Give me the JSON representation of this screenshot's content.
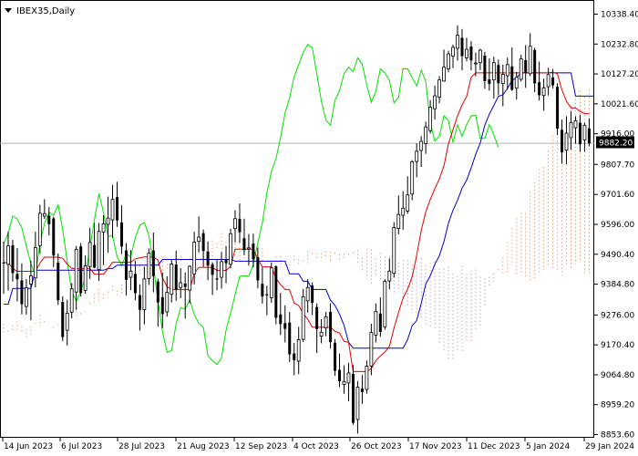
{
  "chart_data": {
    "type": "candlestick",
    "title": "IBEX35,Daily",
    "current_price_label": "9882.20",
    "current_price": 9882.2,
    "y_ticks": [
      "10338.40",
      "10232.80",
      "10127.20",
      "10021.60",
      "9916.00",
      "9807.70",
      "9701.60",
      "9596.00",
      "9490.40",
      "9384.80",
      "9276.00",
      "9170.40",
      "9064.80",
      "8959.20",
      "8853.60"
    ],
    "x_ticks": [
      "14 Jun 2023",
      "6 Jul 2023",
      "28 Jul 2023",
      "21 Aug 2023",
      "12 Sep 2023",
      "4 Oct 2023",
      "26 Oct 2023",
      "17 Nov 2023",
      "11 Dec 2023",
      "5 Jan 2024",
      "29 Jan 2024"
    ],
    "ylim": [
      8853.6,
      10338.4
    ],
    "colors": {
      "candle": "#000000",
      "tenkan_sen": "#e00000",
      "kijun_sen": "#0000c8",
      "chikou_span": "#00e000",
      "cloud_bull": "#f0a070",
      "cloud_bear": "#c8a0c8",
      "price_line": "#b0b0b0"
    },
    "candles": [
      [
        9461,
        9535,
        9351,
        9459
      ],
      [
        9455,
        9570,
        9362,
        9520
      ],
      [
        9522,
        9541,
        9394,
        9424
      ],
      [
        9421,
        9512,
        9324,
        9402
      ],
      [
        9398,
        9458,
        9278,
        9314
      ],
      [
        9306,
        9403,
        9277,
        9372
      ],
      [
        9385,
        9468,
        9257,
        9414
      ],
      [
        9407,
        9570,
        9373,
        9514
      ],
      [
        9521,
        9665,
        9492,
        9635
      ],
      [
        9625,
        9685,
        9615,
        9634
      ],
      [
        9627,
        9657,
        9557,
        9597
      ],
      [
        9617,
        9623,
        9445,
        9486
      ],
      [
        9461,
        9493,
        9311,
        9328
      ],
      [
        9322,
        9342,
        9184,
        9198
      ],
      [
        9222,
        9330,
        9168,
        9282
      ],
      [
        9286,
        9389,
        9264,
        9368
      ],
      [
        9357,
        9520,
        9294,
        9508
      ],
      [
        9518,
        9530,
        9341,
        9354
      ],
      [
        9363,
        9486,
        9351,
        9449
      ],
      [
        9447,
        9584,
        9403,
        9532
      ],
      [
        9523,
        9601,
        9441,
        9443
      ],
      [
        9436,
        9601,
        9396,
        9571
      ],
      [
        9569,
        9628,
        9452,
        9598
      ],
      [
        9596,
        9694,
        9496,
        9618
      ],
      [
        9612,
        9736,
        9548,
        9684
      ],
      [
        9692,
        9746,
        9587,
        9610
      ],
      [
        9603,
        9664,
        9491,
        9518
      ],
      [
        9504,
        9530,
        9344,
        9400
      ],
      [
        9409,
        9505,
        9364,
        9431
      ],
      [
        9421,
        9467,
        9328,
        9353
      ],
      [
        9346,
        9384,
        9221,
        9294
      ],
      [
        9295,
        9446,
        9243,
        9403
      ],
      [
        9404,
        9511,
        9382,
        9494
      ],
      [
        9504,
        9567,
        9356,
        9413
      ],
      [
        9394,
        9404,
        9235,
        9320
      ],
      [
        9339,
        9425,
        9230,
        9279
      ],
      [
        9287,
        9413,
        9270,
        9356
      ],
      [
        9349,
        9470,
        9320,
        9456
      ],
      [
        9454,
        9503,
        9326,
        9365
      ],
      [
        9373,
        9442,
        9335,
        9390
      ],
      [
        9387,
        9426,
        9263,
        9375
      ],
      [
        9364,
        9451,
        9317,
        9448
      ],
      [
        9421,
        9570,
        9384,
        9533
      ],
      [
        9536,
        9624,
        9497,
        9551
      ],
      [
        9565,
        9578,
        9446,
        9502
      ],
      [
        9500,
        9536,
        9399,
        9450
      ],
      [
        9455,
        9462,
        9347,
        9418
      ],
      [
        9405,
        9470,
        9363,
        9401
      ],
      [
        9409,
        9498,
        9369,
        9464
      ],
      [
        9473,
        9520,
        9388,
        9459
      ],
      [
        9455,
        9580,
        9441,
        9563
      ],
      [
        9581,
        9646,
        9532,
        9616
      ],
      [
        9615,
        9670,
        9530,
        9568
      ],
      [
        9547,
        9616,
        9487,
        9505
      ],
      [
        9509,
        9562,
        9450,
        9513
      ],
      [
        9528,
        9563,
        9444,
        9473
      ],
      [
        9480,
        9514,
        9370,
        9398
      ],
      [
        9386,
        9444,
        9316,
        9341
      ],
      [
        9349,
        9379,
        9275,
        9345
      ],
      [
        9337,
        9461,
        9319,
        9442
      ],
      [
        9448,
        9451,
        9243,
        9266
      ],
      [
        9278,
        9354,
        9205,
        9244
      ],
      [
        9247,
        9310,
        9179,
        9227
      ],
      [
        9249,
        9287,
        9110,
        9137
      ],
      [
        9140,
        9177,
        9063,
        9116
      ],
      [
        9113,
        9234,
        9067,
        9189
      ],
      [
        9190,
        9368,
        9181,
        9340
      ],
      [
        9326,
        9403,
        9284,
        9373
      ],
      [
        9380,
        9391,
        9275,
        9319
      ],
      [
        9304,
        9317,
        9142,
        9226
      ],
      [
        9201,
        9261,
        9176,
        9215
      ],
      [
        9230,
        9287,
        9201,
        9270
      ],
      [
        9287,
        9317,
        9158,
        9180
      ],
      [
        9178,
        9191,
        9061,
        9079
      ],
      [
        9082,
        9140,
        9021,
        9042
      ],
      [
        9031,
        9098,
        8998,
        9041
      ],
      [
        9036,
        9107,
        8971,
        9071
      ],
      [
        9068,
        9099,
        8888,
        8895
      ],
      [
        8907,
        9043,
        8857,
        9021
      ],
      [
        9016,
        9064,
        8962,
        9004
      ],
      [
        9013,
        9115,
        8998,
        9095
      ],
      [
        9096,
        9245,
        9063,
        9214
      ],
      [
        9205,
        9317,
        9179,
        9289
      ],
      [
        9281,
        9338,
        9199,
        9216
      ],
      [
        9234,
        9402,
        9224,
        9395
      ],
      [
        9396,
        9476,
        9366,
        9431
      ],
      [
        9423,
        9604,
        9408,
        9585
      ],
      [
        9581,
        9698,
        9561,
        9631
      ],
      [
        9628,
        9713,
        9577,
        9653
      ],
      [
        9643,
        9766,
        9633,
        9700
      ],
      [
        9703,
        9823,
        9681,
        9817
      ],
      [
        9818,
        9882,
        9762,
        9854
      ],
      [
        9857,
        9908,
        9799,
        9889
      ],
      [
        9881,
        9959,
        9845,
        9940
      ],
      [
        9927,
        10035,
        9917,
        10010
      ],
      [
        10004,
        10086,
        9966,
        10050
      ],
      [
        10045,
        10120,
        10024,
        10106
      ],
      [
        10102,
        10213,
        10100,
        10151
      ],
      [
        10145,
        10209,
        10133,
        10198
      ],
      [
        10190,
        10231,
        10148,
        10221
      ],
      [
        10218,
        10299,
        10174,
        10264
      ],
      [
        10255,
        10286,
        10140,
        10190
      ],
      [
        10184,
        10255,
        10172,
        10214
      ],
      [
        10224,
        10243,
        10140,
        10175
      ],
      [
        10163,
        10203,
        10119,
        10166
      ],
      [
        10167,
        10216,
        10141,
        10211
      ],
      [
        10192,
        10205,
        10075,
        10102
      ],
      [
        10108,
        10182,
        10068,
        10092
      ],
      [
        10106,
        10188,
        10040,
        10167
      ],
      [
        10159,
        10178,
        10052,
        10094
      ],
      [
        10093,
        10160,
        10013,
        10126
      ],
      [
        10121,
        10185,
        10073,
        10160
      ],
      [
        10154,
        10221,
        10067,
        10071
      ],
      [
        10077,
        10134,
        10037,
        10115
      ],
      [
        10108,
        10195,
        10101,
        10181
      ],
      [
        10176,
        10229,
        10078,
        10131
      ],
      [
        10128,
        10271,
        10119,
        10225
      ],
      [
        10212,
        10220,
        10063,
        10094
      ],
      [
        10098,
        10171,
        10033,
        10052
      ],
      [
        10051,
        10111,
        9997,
        10078
      ],
      [
        10082,
        10149,
        10051,
        10125
      ],
      [
        10115,
        10145,
        10076,
        10087
      ],
      [
        10082,
        10094,
        9911,
        9934
      ],
      [
        9930,
        9966,
        9810,
        9850
      ],
      [
        9858,
        9978,
        9809,
        9918
      ],
      [
        9902,
        9995,
        9860,
        9956
      ],
      [
        9937,
        9978,
        9881,
        9962
      ],
      [
        9955,
        9983,
        9852,
        9879
      ],
      [
        9894,
        9955,
        9853,
        9946
      ],
      [
        9935,
        9971,
        9871,
        9882
      ]
    ],
    "tenkan_sen": [
      9461,
      9461,
      9440,
      9430,
      9430,
      9430,
      9430,
      9430,
      9459,
      9480,
      9480,
      9480,
      9480,
      9476,
      9456,
      9440,
      9440,
      9440,
      9440,
      9440,
      9420,
      9420,
      9420,
      9440,
      9462,
      9462,
      9462,
      9462,
      9462,
      9474,
      9478,
      9481,
      9481,
      9480,
      9470,
      9408,
      9375,
      9366,
      9366,
      9366,
      9366,
      9366,
      9423,
      9444,
      9444,
      9444,
      9444,
      9433,
      9433,
      9433,
      9448,
      9508,
      9508,
      9508,
      9508,
      9508,
      9473,
      9446,
      9446,
      9446,
      9405,
      9383,
      9366,
      9365,
      9318,
      9309,
      9282,
      9260,
      9233,
      9233,
      9233,
      9233,
      9233,
      9218,
      9212,
      9183,
      9179,
      9076,
      9076,
      9076,
      9076,
      9087,
      9115,
      9131,
      9145,
      9165,
      9230,
      9285,
      9335,
      9367,
      9410,
      9487,
      9575,
      9639,
      9684,
      9722,
      9757,
      9803,
      9880,
      9930,
      9979,
      10018,
      10048,
      10115,
      10131,
      10131,
      10131,
      10131,
      10131,
      10131,
      10131,
      10131,
      10131,
      10131,
      10131,
      10131,
      10131,
      10131,
      10131,
      10131,
      10131,
      10134,
      10127,
      10071,
      10031,
      10007,
      10007,
      9995,
      9987,
      9987
    ],
    "kijun_sen": [
      9314,
      9314,
      9370,
      9370,
      9370,
      9370,
      9370,
      9434,
      9434,
      9434,
      9434,
      9434,
      9434,
      9434,
      9434,
      9434,
      9434,
      9434,
      9434,
      9434,
      9434,
      9434,
      9434,
      9440,
      9440,
      9452,
      9452,
      9452,
      9452,
      9452,
      9452,
      9452,
      9452,
      9452,
      9452,
      9472,
      9472,
      9472,
      9472,
      9472,
      9472,
      9472,
      9472,
      9472,
      9472,
      9472,
      9472,
      9472,
      9472,
      9472,
      9472,
      9466,
      9466,
      9466,
      9466,
      9466,
      9466,
      9466,
      9466,
      9466,
      9466,
      9466,
      9466,
      9421,
      9421,
      9421,
      9395,
      9395,
      9366,
      9366,
      9366,
      9366,
      9328,
      9310,
      9279,
      9239,
      9179,
      9159,
      9159,
      9159,
      9159,
      9159,
      9159,
      9159,
      9159,
      9159,
      9159,
      9159,
      9159,
      9189,
      9238,
      9257,
      9317,
      9385,
      9415,
      9455,
      9486,
      9535,
      9600,
      9646,
      9681,
      9724,
      9752,
      9795,
      9843,
      9883,
      9946,
      9985,
      10016,
      10048,
      10054,
      10076,
      10105,
      10113,
      10131,
      10131,
      10131,
      10131,
      10131,
      10131,
      10131,
      10131,
      10131,
      10131,
      10131,
      10131,
      10049,
      10049,
      10049,
      10049,
      10049
    ],
    "chikou_span": [
      9527,
      9565,
      9625,
      9615,
      9584,
      9520,
      9457,
      9416,
      9529,
      9599,
      9638,
      9628,
      9665,
      9580,
      9466,
      9359,
      9324,
      9358,
      9411,
      9512,
      9612,
      9705,
      9637,
      9553,
      9556,
      9481,
      9451,
      9492,
      9481,
      9548,
      9593,
      9602,
      9557,
      9450,
      9325,
      9217,
      9144,
      9150,
      9244,
      9302,
      9297,
      9330,
      9277,
      9246,
      9232,
      9133,
      9114,
      9101,
      9124,
      9222,
      9282,
      9349,
      9412,
      9415,
      9412,
      9454,
      9531,
      9602,
      9706,
      9783,
      9828,
      9902,
      9990,
      10042,
      10117,
      10160,
      10203,
      10231,
      10219,
      10128,
      10031,
      9964,
      9946,
      10034,
      10068,
      10128,
      10151,
      10135,
      10184,
      10162,
      10088,
      10027,
      10066,
      10145,
      10131,
      10104,
      10025,
      10045,
      10146,
      10145,
      10114,
      10085,
      10140,
      10101,
      9954,
      9890,
      9907,
      9980,
      9963,
      9885,
      9947,
      9907,
      9948,
      9979,
      9982,
      9900,
      9899,
      9948,
      9912,
      9869
    ],
    "span_a": [
      9258,
      9247,
      9219,
      9247,
      9245,
      9217,
      9240,
      9253,
      9235,
      9197,
      9207,
      9248,
      9278,
      9244,
      9237,
      9236,
      9244,
      9236,
      9265,
      9295,
      9315,
      9275,
      9286,
      9320,
      9351,
      9368,
      9351,
      9359,
      9378,
      9362,
      9350,
      9389,
      9376,
      9404,
      9450,
      9444,
      9441,
      9449,
      9428,
      9464,
      9456,
      9454,
      9479,
      9485,
      9454,
      9475,
      9463,
      9509,
      9498,
      9531,
      9539,
      9530,
      9565,
      9533,
      9539,
      9554,
      9513,
      9506,
      9524,
      9509,
      9512,
      9512,
      9489,
      9463,
      9461,
      9443,
      9447,
      9441,
      9462,
      9452,
      9463,
      9501,
      9496,
      9494,
      9494,
      9481,
      9499,
      9483,
      9468,
      9476,
      9486,
      9484,
      9455,
      9425,
      9404,
      9386,
      9412,
      9396,
      9395,
      9375,
      9353,
      9362,
      9332,
      9303,
      9284,
      9276,
      9265,
      9232,
      9233,
      9222,
      9170,
      9147,
      9119,
      9118,
      9150,
      9140,
      9176,
      9180,
      9217,
      9232,
      9309,
      9379,
      9393,
      9440,
      9479,
      9535,
      9583,
      9618,
      9637,
      9636,
      9712,
      9745,
      9791,
      9799,
      9856,
      9910,
      9943,
      9959,
      9975,
      10014,
      10038,
      10068,
      10047,
      10071
    ],
    "span_b": [
      9228,
      9236,
      9211,
      9208,
      9206,
      9222,
      9213,
      9215,
      9216,
      9227,
      9236,
      9245,
      9237,
      9255,
      9236,
      9222,
      9233,
      9245,
      9266,
      9262,
      9262,
      9283,
      9289,
      9311,
      9311,
      9324,
      9329,
      9351,
      9359,
      9346,
      9384,
      9390,
      9398,
      9389,
      9421,
      9419,
      9410,
      9417,
      9429,
      9421,
      9432,
      9458,
      9459,
      9466,
      9456,
      9477,
      9493,
      9483,
      9471,
      9469,
      9475,
      9507,
      9481,
      9476,
      9493,
      9483,
      9469,
      9470,
      9447,
      9470,
      9483,
      9461,
      9488,
      9468,
      9483,
      9484,
      9467,
      9455,
      9487,
      9474,
      9469,
      9459,
      9489,
      9470,
      9472,
      9501,
      9464,
      9496,
      9491,
      9493,
      9493,
      9498,
      9505,
      9478,
      9510,
      9507,
      9475,
      9496,
      9482,
      9485,
      9464,
      9462,
      9471,
      9470,
      9453,
      9481,
      9476,
      9452,
      9461,
      9466,
      9440,
      9441,
      9448,
      9422,
      9414,
      9450,
      9421,
      9433,
      9436,
      9411,
      9406,
      9411,
      9422,
      9434,
      9416,
      9425,
      9451,
      9416,
      9417,
      9404,
      9394,
      9396,
      9416,
      9435,
      9448,
      9442,
      9432,
      9416,
      9453,
      9436,
      9455,
      9467,
      9425,
      9421
    ]
  }
}
